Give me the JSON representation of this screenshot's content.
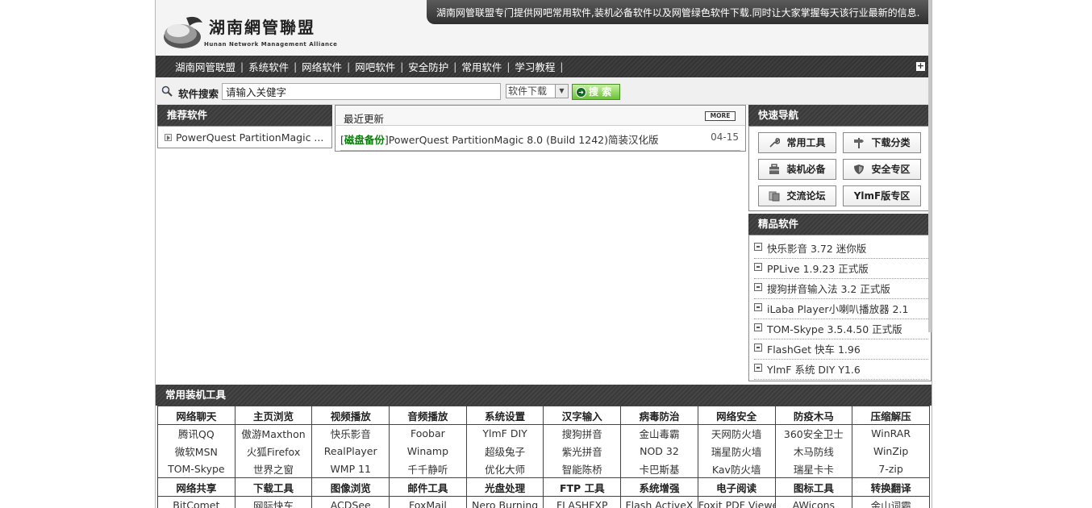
{
  "header": {
    "logo_cn": "湖南網管聯盟",
    "logo_en": "Hunan Network Management Alliance",
    "notice": "湖南网管联盟专门提供网吧常用软件,装机必备软件以及网管绿色软件下载.同时让大家掌握每天该行业最新的信息."
  },
  "nav": {
    "items": [
      "湖南网管联盟",
      "系统软件",
      "网络软件",
      "网吧软件",
      "安全防护",
      "常用软件",
      "学习教程"
    ],
    "plus": "+"
  },
  "search": {
    "label": "软件搜索",
    "input_value": "请输入关健字",
    "select_value": "软件下载",
    "button": "搜 索"
  },
  "recommend": {
    "title": "推荐软件",
    "items": [
      "PowerQuest PartitionMagic ..."
    ]
  },
  "recent": {
    "title": "最近更新",
    "more": "MORE",
    "items": [
      {
        "category": "磁盘备份",
        "title": "PowerQuest PartitionMagic 8.0 (Build 1242)简装汉化版",
        "date": "04-15"
      }
    ]
  },
  "quicknav": {
    "title": "快速导航",
    "buttons": [
      "常用工具",
      "下载分类",
      "装机必备",
      "安全专区",
      "交流论坛",
      "YlmF版专区"
    ]
  },
  "featured": {
    "title": "精品软件",
    "items": [
      "快乐影音 3.72 迷你版",
      "PPLive 1.9.23 正式版",
      "搜狗拼音输入法 3.2 正式版",
      "iLaba Player小喇叭播放器 2.1",
      "TOM-Skype 3.5.4.50 正式版",
      "FlashGet 快车 1.96",
      "YlmF 系统 DIY Y1.6"
    ]
  },
  "tools": {
    "title": "常用装机工具",
    "groups": [
      {
        "headers": [
          "网络聊天",
          "主页浏览",
          "视频播放",
          "音频播放",
          "系统设置",
          "汉字输入",
          "病毒防治",
          "网络安全",
          "防疫木马",
          "压缩解压"
        ],
        "rows": [
          [
            "腾讯QQ",
            "傲游Maxthon",
            "快乐影音",
            "Foobar",
            "YlmF DIY",
            "搜狗拼音",
            "金山毒霸",
            "天网防火墙",
            "360安全卫士",
            "WinRAR"
          ],
          [
            "微软MSN",
            "火狐Firefox",
            "RealPlayer",
            "Winamp",
            "超级兔子",
            "紫光拼音",
            "NOD 32",
            "瑞星防火墙",
            "木马防线",
            "WinZip"
          ],
          [
            "TOM-Skype",
            "世界之窗",
            "WMP 11",
            "千千静听",
            "优化大师",
            "智能陈桥",
            "卡巴斯基",
            "Kav防火墙",
            "瑞星卡卡",
            "7-zip"
          ]
        ]
      },
      {
        "headers": [
          "网络共享",
          "下载工具",
          "图像浏览",
          "邮件工具",
          "光盘处理",
          "FTP 工具",
          "系统增强",
          "电子阅读",
          "图标工具",
          "转换翻译"
        ],
        "rows": [
          [
            "BitComet",
            "网际快车",
            "ACDSee",
            "FoxMail",
            "Nero Burning",
            "FLASHFXP",
            "Flash ActiveX",
            "Foxit PDF Viewer",
            "AWicons",
            "金山词霸"
          ]
        ]
      }
    ]
  },
  "colors": {
    "panel_dark": "#404040",
    "accent_green": "#0a7d0a",
    "button_green": "#6cc23a"
  }
}
